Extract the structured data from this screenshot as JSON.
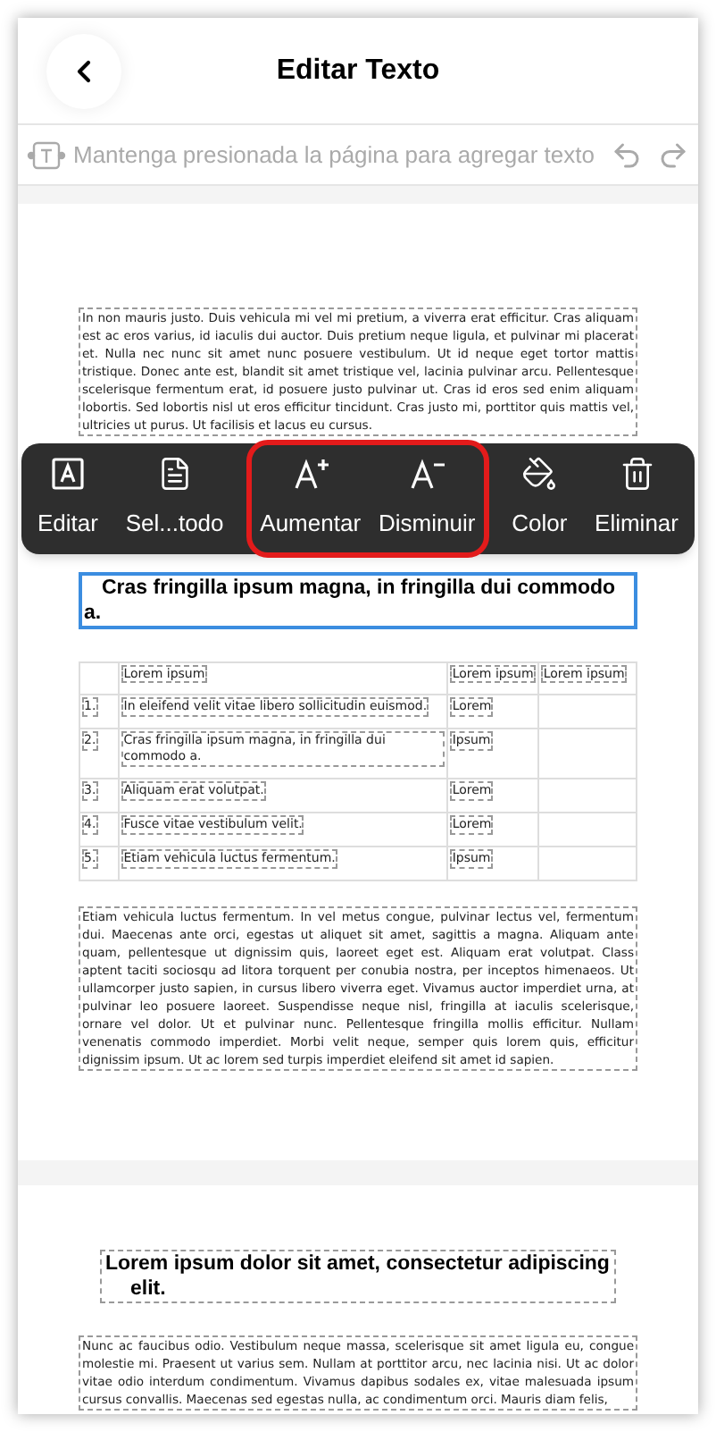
{
  "header": {
    "title": "Editar Texto"
  },
  "hint_bar": {
    "text": "Mantenga presionada la página para agregar texto"
  },
  "document": {
    "paragraph_1": "In non mauris justo. Duis vehicula mi vel mi pretium, a viverra erat efficitur. Cras aliquam est ac eros varius, id iaculis dui auctor. Duis pretium neque ligula, et pulvinar mi placerat et. Nulla nec nunc sit amet nunc posuere vestibulum. Ut id neque eget tortor mattis tristique. Donec ante est, blandit sit amet tristique vel, lacinia pulvinar arcu. Pellentesque scelerisque fermentum erat, id posuere justo pulvinar ut. Cras id eros sed enim aliquam lobortis. Sed lobortis nisl ut eros efficitur tincidunt. Cras justo mi, porttitor quis mattis vel, ultricies ut purus. Ut facilisis et lacus eu cursus.",
    "toolbar": [
      {
        "kind": "edit",
        "label": "Editar",
        "highlighted": false
      },
      {
        "kind": "select",
        "label": "Sel...todo",
        "highlighted": false
      },
      {
        "kind": "increase",
        "label": "Aumentar",
        "highlighted": true
      },
      {
        "kind": "decrease",
        "label": "Disminuir",
        "highlighted": true
      },
      {
        "kind": "color",
        "label": "Color",
        "highlighted": false
      },
      {
        "kind": "delete",
        "label": "Eliminar",
        "highlighted": false
      }
    ],
    "selected_heading": {
      "text": "Cras fringilla ipsum magna, in fringilla dui commodo a.",
      "selected": true
    },
    "table": {
      "columns": [
        "",
        "Lorem ipsum",
        "Lorem ipsum",
        "Lorem ipsum"
      ],
      "rows": [
        [
          "1.",
          "In eleifend velit vitae libero sollicitudin euismod.",
          "Lorem",
          ""
        ],
        [
          "2.",
          "Cras fringilla ipsum magna, in fringilla dui commodo a.",
          "Ipsum",
          ""
        ],
        [
          "3.",
          "Aliquam erat volutpat.",
          "Lorem",
          ""
        ],
        [
          "4.",
          "Fusce vitae vestibulum velit.",
          "Lorem",
          ""
        ],
        [
          "5.",
          "Etiam vehicula luctus fermentum.",
          "Ipsum",
          ""
        ]
      ]
    },
    "paragraph_2": "Etiam vehicula luctus fermentum. In vel metus congue, pulvinar lectus vel, fermentum dui. Maecenas ante orci, egestas ut aliquet sit amet, sagittis a magna. Aliquam ante quam, pellentesque ut dignissim quis, laoreet eget est. Aliquam erat volutpat. Class aptent taciti sociosqu ad litora torquent per conubia nostra, per inceptos himenaeos. Ut ullamcorper justo sapien, in cursus libero viverra eget. Vivamus auctor imperdiet urna, at pulvinar leo posuere laoreet. Suspendisse neque nisl, fringilla at iaculis scelerisque, ornare vel dolor. Ut et pulvinar nunc. Pellentesque fringilla mollis efficitur. Nullam venenatis commodo imperdiet. Morbi velit neque, semper quis lorem quis, efficitur dignissim ipsum. Ut ac lorem sed turpis imperdiet eleifend sit amet id sapien.",
    "heading_2": "Lorem ipsum dolor sit amet, consectetur adipiscing elit.",
    "paragraph_3": "Nunc ac faucibus odio. Vestibulum neque massa, scelerisque sit amet ligula eu, congue molestie mi. Praesent ut varius sem. Nullam at porttitor arcu, nec lacinia nisi. Ut ac dolor vitae odio interdum condimentum. Vivamus dapibus sodales ex, vitae malesuada ipsum cursus convallis. Maecenas sed egestas nulla, ac condimentum orci. Mauris diam felis,"
  }
}
